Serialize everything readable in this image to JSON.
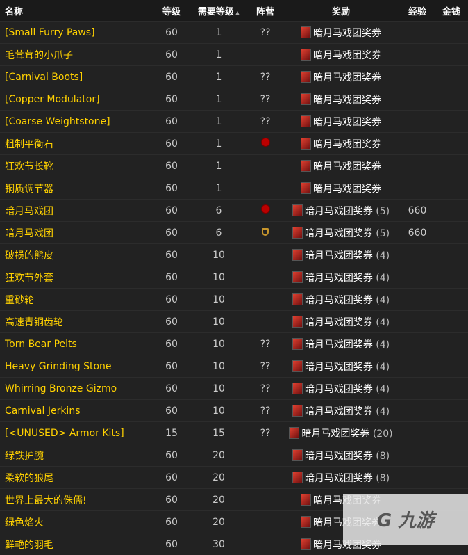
{
  "headers": {
    "name": "名称",
    "level": "等级",
    "req_level": "需要等级",
    "faction": "阵营",
    "reward": "奖励",
    "xp": "经验",
    "money": "金钱"
  },
  "sort": {
    "column": "req_level",
    "direction": "ascending"
  },
  "rows": [
    {
      "name": "[Small Furry Paws]",
      "level": "60",
      "req": "1",
      "faction": "??",
      "reward": "暗月马戏团奖券",
      "count": "",
      "xp": ""
    },
    {
      "name": "毛茸茸的小爪子",
      "level": "60",
      "req": "1",
      "faction": "",
      "reward": "暗月马戏团奖券",
      "count": "",
      "xp": ""
    },
    {
      "name": "[Carnival Boots]",
      "level": "60",
      "req": "1",
      "faction": "??",
      "reward": "暗月马戏团奖券",
      "count": "",
      "xp": ""
    },
    {
      "name": "[Copper Modulator]",
      "level": "60",
      "req": "1",
      "faction": "??",
      "reward": "暗月马戏团奖券",
      "count": "",
      "xp": ""
    },
    {
      "name": "[Coarse Weightstone]",
      "level": "60",
      "req": "1",
      "faction": "??",
      "reward": "暗月马戏团奖券",
      "count": "",
      "xp": ""
    },
    {
      "name": "粗制平衡石",
      "level": "60",
      "req": "1",
      "faction": "horde",
      "reward": "暗月马戏团奖券",
      "count": "",
      "xp": ""
    },
    {
      "name": "狂欢节长靴",
      "level": "60",
      "req": "1",
      "faction": "",
      "reward": "暗月马戏团奖券",
      "count": "",
      "xp": ""
    },
    {
      "name": "铜质调节器",
      "level": "60",
      "req": "1",
      "faction": "",
      "reward": "暗月马戏团奖券",
      "count": "",
      "xp": ""
    },
    {
      "name": "暗月马戏团",
      "level": "60",
      "req": "6",
      "faction": "horde",
      "reward": "暗月马戏团奖券",
      "count": "(5)",
      "xp": "660"
    },
    {
      "name": "暗月马戏团",
      "level": "60",
      "req": "6",
      "faction": "alliance",
      "reward": "暗月马戏团奖券",
      "count": "(5)",
      "xp": "660"
    },
    {
      "name": "破损的熊皮",
      "level": "60",
      "req": "10",
      "faction": "",
      "reward": "暗月马戏团奖券",
      "count": "(4)",
      "xp": ""
    },
    {
      "name": "狂欢节外套",
      "level": "60",
      "req": "10",
      "faction": "",
      "reward": "暗月马戏团奖券",
      "count": "(4)",
      "xp": ""
    },
    {
      "name": "重砂轮",
      "level": "60",
      "req": "10",
      "faction": "",
      "reward": "暗月马戏团奖券",
      "count": "(4)",
      "xp": ""
    },
    {
      "name": "高速青铜齿轮",
      "level": "60",
      "req": "10",
      "faction": "",
      "reward": "暗月马戏团奖券",
      "count": "(4)",
      "xp": ""
    },
    {
      "name": "Torn Bear Pelts",
      "level": "60",
      "req": "10",
      "faction": "??",
      "reward": "暗月马戏团奖券",
      "count": "(4)",
      "xp": ""
    },
    {
      "name": "Heavy Grinding Stone",
      "level": "60",
      "req": "10",
      "faction": "??",
      "reward": "暗月马戏团奖券",
      "count": "(4)",
      "xp": ""
    },
    {
      "name": "Whirring Bronze Gizmo",
      "level": "60",
      "req": "10",
      "faction": "??",
      "reward": "暗月马戏团奖券",
      "count": "(4)",
      "xp": ""
    },
    {
      "name": "Carnival Jerkins",
      "level": "60",
      "req": "10",
      "faction": "??",
      "reward": "暗月马戏团奖券",
      "count": "(4)",
      "xp": ""
    },
    {
      "name": "[<UNUSED> Armor Kits]",
      "level": "15",
      "req": "15",
      "faction": "??",
      "reward": "暗月马戏团奖券",
      "count": "(20)",
      "xp": ""
    },
    {
      "name": "绿铁护腕",
      "level": "60",
      "req": "20",
      "faction": "",
      "reward": "暗月马戏团奖券",
      "count": "(8)",
      "xp": ""
    },
    {
      "name": "柔软的狼尾",
      "level": "60",
      "req": "20",
      "faction": "",
      "reward": "暗月马戏团奖券",
      "count": "(8)",
      "xp": ""
    },
    {
      "name": "世界上最大的侏儒!",
      "level": "60",
      "req": "20",
      "faction": "",
      "reward": "暗月马戏团奖券",
      "count": "",
      "xp": ""
    },
    {
      "name": "绿色焰火",
      "level": "60",
      "req": "20",
      "faction": "",
      "reward": "暗月马戏团奖券",
      "count": "",
      "xp": ""
    },
    {
      "name": "鲜艳的羽毛",
      "level": "60",
      "req": "30",
      "faction": "",
      "reward": "暗月马戏团奖券",
      "count": "",
      "xp": ""
    }
  ],
  "watermark": "九游"
}
